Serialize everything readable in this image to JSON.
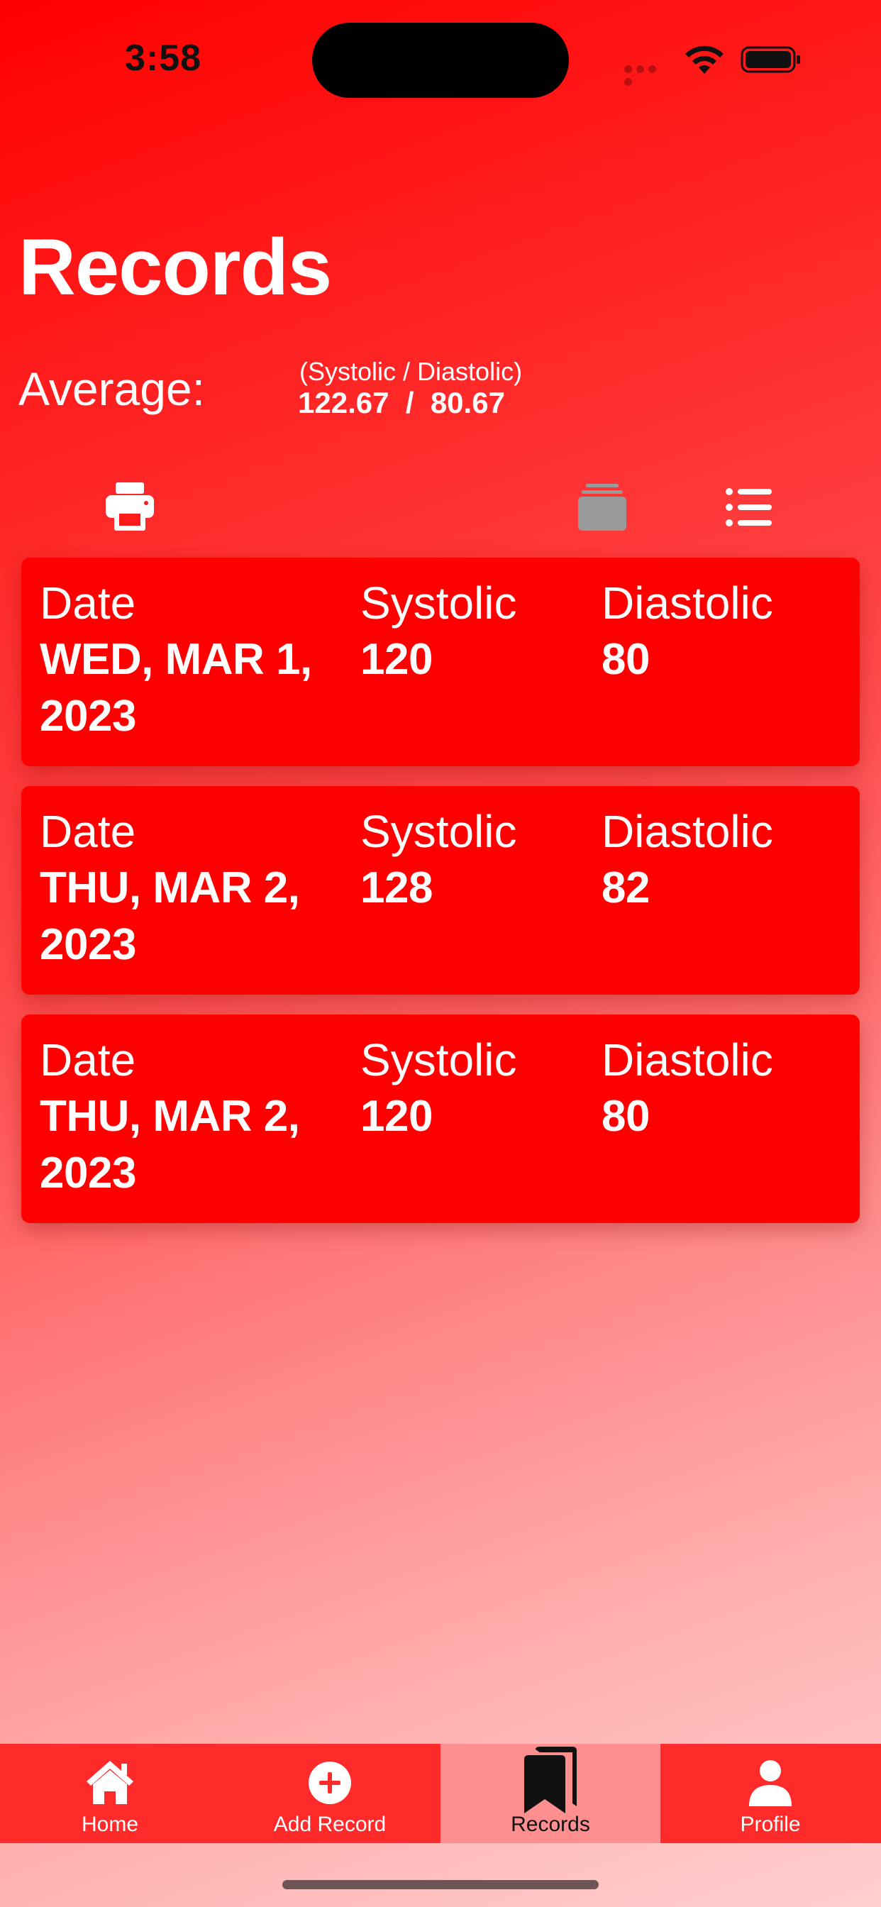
{
  "status_bar": {
    "time": "3:58"
  },
  "header": {
    "title": "Records",
    "average_label": "Average:",
    "average_caption": "(Systolic / Diastolic)",
    "average_systolic": "122.67",
    "average_separator": "/",
    "average_diastolic": "80.67"
  },
  "toolbar": {
    "icons": [
      "print-icon",
      "stack-icon",
      "list-icon"
    ]
  },
  "records": [
    {
      "date_label": "Date",
      "date": "WED, MAR 1, 2023",
      "systolic_label": "Systolic",
      "systolic": "120",
      "diastolic_label": "Diastolic",
      "diastolic": "80"
    },
    {
      "date_label": "Date",
      "date": "THU, MAR 2, 2023",
      "systolic_label": "Systolic",
      "systolic": "128",
      "diastolic_label": "Diastolic",
      "diastolic": "82"
    },
    {
      "date_label": "Date",
      "date": "THU, MAR 2, 2023",
      "systolic_label": "Systolic",
      "systolic": "120",
      "diastolic_label": "Diastolic",
      "diastolic": "80"
    }
  ],
  "tab_bar": {
    "items": [
      {
        "label": "Home",
        "icon": "home-icon"
      },
      {
        "label": "Add Record",
        "icon": "add-circle-icon"
      },
      {
        "label": "Records",
        "icon": "bookmarks-icon",
        "active": true
      },
      {
        "label": "Profile",
        "icon": "person-icon"
      }
    ]
  },
  "colors": {
    "primary": "#ff0000",
    "tab_bar": "#ff2a2a",
    "active_tab": "#ff8f8f"
  }
}
